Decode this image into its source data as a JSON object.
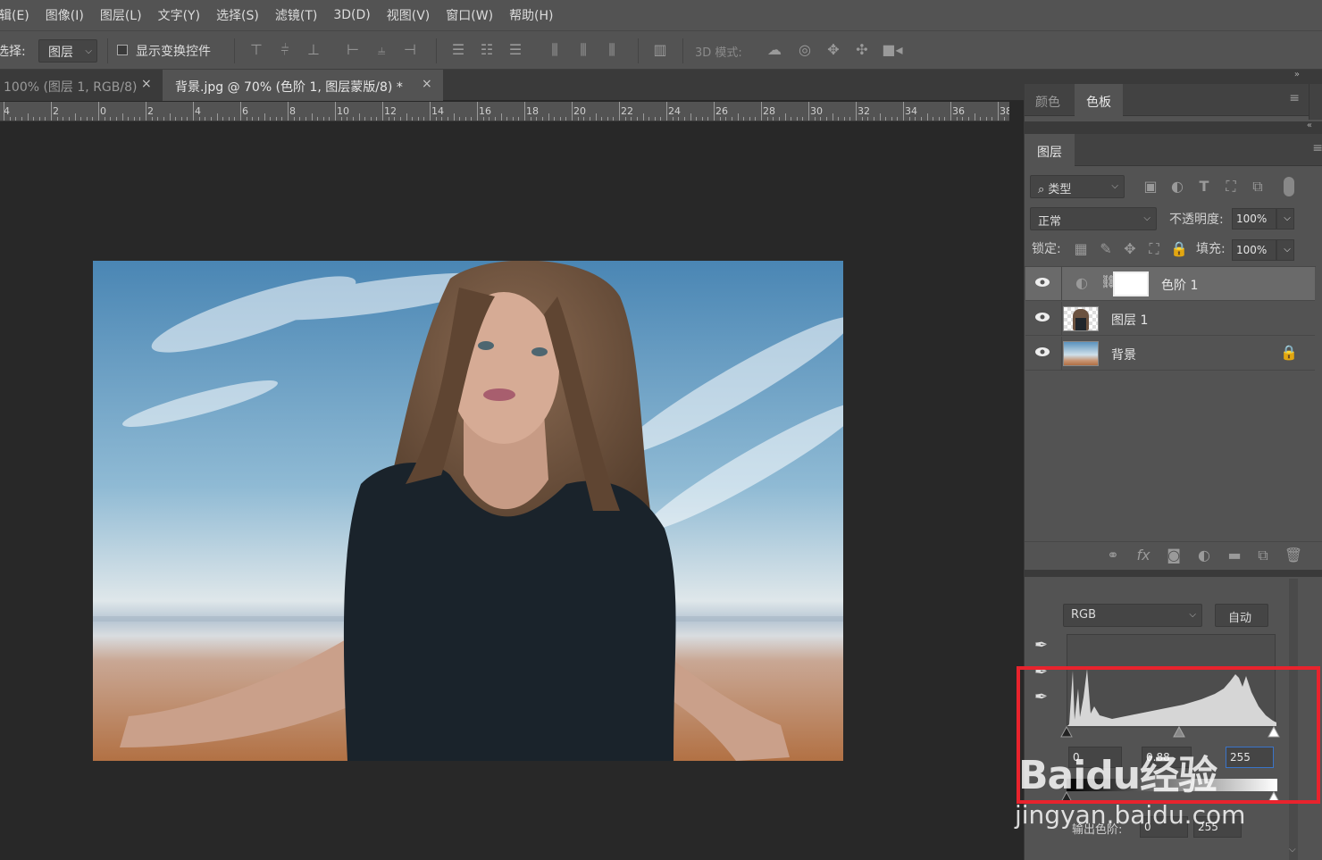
{
  "menu": [
    "辑(E)",
    "图像(I)",
    "图层(L)",
    "文字(Y)",
    "选择(S)",
    "滤镜(T)",
    "3D(D)",
    "视图(V)",
    "窗口(W)",
    "帮助(H)"
  ],
  "options": {
    "select_label": "选择:",
    "select_value": "图层",
    "transform_label": "显示变换控件",
    "mode3d_label": "3D 模式:"
  },
  "tabs": [
    {
      "label": "100% (图层 1, RGB/8)",
      "close": "×"
    },
    {
      "label": "背景.jpg @ 70% (色阶 1, 图层蒙版/8) *",
      "close": "×"
    }
  ],
  "ruler": [
    "4",
    "2",
    "0",
    "2",
    "4",
    "6",
    "8",
    "10",
    "12",
    "14",
    "16",
    "18",
    "20",
    "22",
    "24",
    "26",
    "28",
    "30",
    "32",
    "34",
    "36",
    "38"
  ],
  "color_panel": {
    "tabs": [
      "颜色",
      "色板"
    ],
    "active": "色板"
  },
  "layers_panel": {
    "title": "图层",
    "filter_value": "类型",
    "blend_mode": "正常",
    "opacity_label": "不透明度:",
    "opacity_value": "100%",
    "lock_label": "锁定:",
    "fill_label": "填充:",
    "fill_value": "100%",
    "layers": [
      {
        "name": "色阶 1",
        "selected": true
      },
      {
        "name": "图层 1",
        "selected": false
      },
      {
        "name": "背景",
        "selected": false
      }
    ]
  },
  "levels": {
    "channel": "RGB",
    "auto_label": "自动",
    "input_black": "0",
    "input_gamma": "0.88",
    "input_white": "255",
    "output_label": "输出色阶:",
    "output_black": "0",
    "output_white": "255"
  },
  "watermark": {
    "brand": "Baidu经验",
    "url": "jingyan.baidu.com"
  }
}
